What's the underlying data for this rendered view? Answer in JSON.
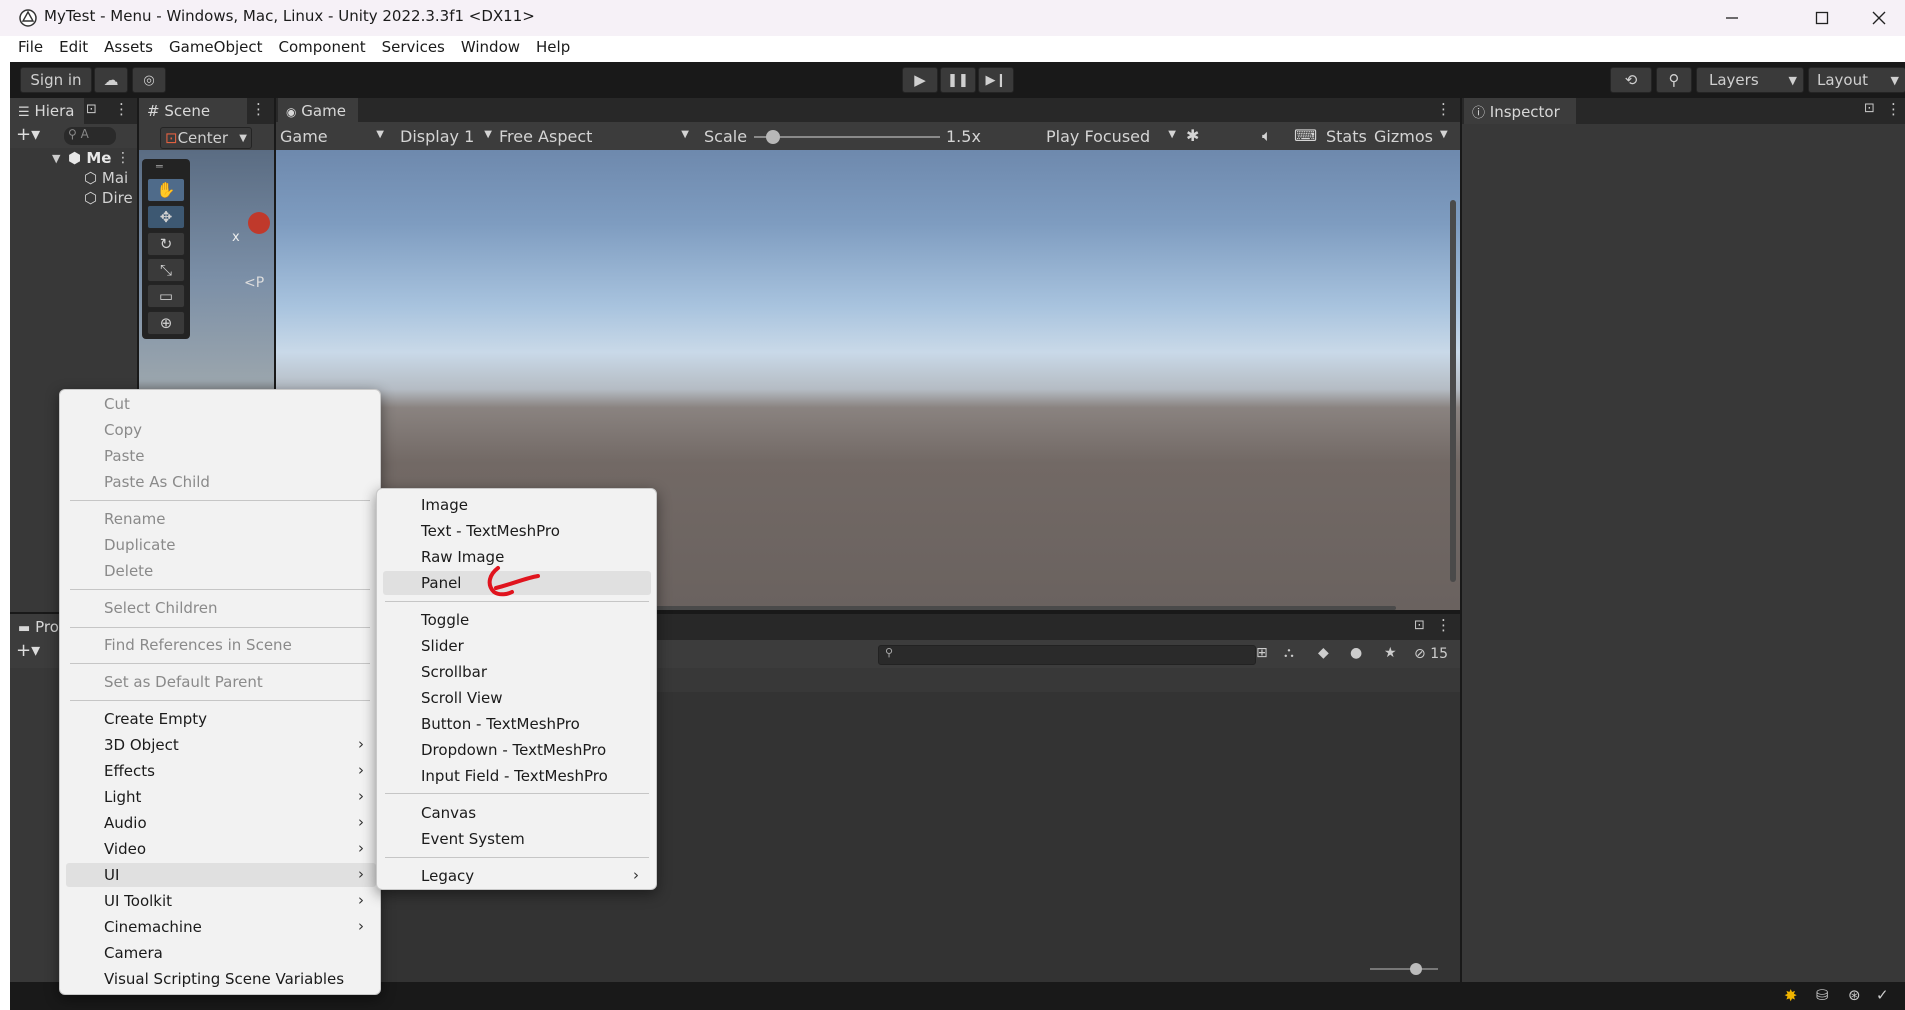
{
  "window": {
    "title": "MyTest - Menu - Windows, Mac, Linux - Unity 2022.3.3f1 <DX11>",
    "app_icon": "unity-logo-icon",
    "controls": [
      "minimize-icon",
      "maximize-icon",
      "close-icon"
    ]
  },
  "menubar": [
    "File",
    "Edit",
    "Assets",
    "GameObject",
    "Component",
    "Services",
    "Window",
    "Help"
  ],
  "toolbar": {
    "sign_in": "Sign in",
    "layers": "Layers",
    "layout": "Layout"
  },
  "hierarchy": {
    "tab": "Hiera",
    "search_placeholder": "A",
    "scene": "Me",
    "items": [
      "Mai",
      "Dire"
    ]
  },
  "scene": {
    "tab": "Scene",
    "pivot": "Center",
    "axis_x": "x",
    "persp": "<P"
  },
  "game": {
    "tab": "Game",
    "mode": "Game",
    "display": "Display 1",
    "aspect": "Free Aspect",
    "scale_label": "Scale",
    "scale_value": "1.5x",
    "scale_fraction": 0.1,
    "play_mode": "Play Focused",
    "stats": "Stats",
    "gizmos": "Gizmos"
  },
  "inspector": {
    "tab": "Inspector"
  },
  "project": {
    "tab": "Pro",
    "hidden_count": "15"
  },
  "context_menu": {
    "items": [
      {
        "label": "Cut",
        "disabled": true
      },
      {
        "label": "Copy",
        "disabled": true
      },
      {
        "label": "Paste",
        "disabled": true
      },
      {
        "label": "Paste As Child",
        "disabled": true
      },
      {
        "label": "Rename",
        "disabled": true
      },
      {
        "label": "Duplicate",
        "disabled": true
      },
      {
        "label": "Delete",
        "disabled": true
      },
      {
        "label": "Select Children",
        "disabled": true
      },
      {
        "label": "Find References in Scene",
        "disabled": true
      },
      {
        "label": "Set as Default Parent",
        "disabled": true
      },
      {
        "label": "Create Empty",
        "disabled": false
      },
      {
        "label": "3D Object",
        "submenu": true
      },
      {
        "label": "Effects",
        "submenu": true
      },
      {
        "label": "Light",
        "submenu": true
      },
      {
        "label": "Audio",
        "submenu": true
      },
      {
        "label": "Video",
        "submenu": true
      },
      {
        "label": "UI",
        "submenu": true,
        "highlighted": true
      },
      {
        "label": "UI Toolkit",
        "submenu": true
      },
      {
        "label": "Cinemachine",
        "submenu": true
      },
      {
        "label": "Camera"
      },
      {
        "label": "Visual Scripting Scene Variables"
      }
    ]
  },
  "ui_submenu": {
    "items": [
      {
        "label": "Image"
      },
      {
        "label": "Text - TextMeshPro"
      },
      {
        "label": "Raw Image"
      },
      {
        "label": "Panel",
        "highlighted": true
      },
      {
        "label": "Toggle"
      },
      {
        "label": "Slider"
      },
      {
        "label": "Scrollbar"
      },
      {
        "label": "Scroll View"
      },
      {
        "label": "Button - TextMeshPro"
      },
      {
        "label": "Dropdown - TextMeshPro"
      },
      {
        "label": "Input Field - TextMeshPro"
      },
      {
        "label": "Canvas"
      },
      {
        "label": "Event System"
      },
      {
        "label": "Legacy",
        "submenu": true
      }
    ],
    "annotation_color": "#e0141e"
  },
  "colors": {
    "editor_bg": "#191919",
    "panel_bg": "#383838",
    "menu_bg": "#f2f2f2",
    "highlight": "#e0e0e0"
  }
}
